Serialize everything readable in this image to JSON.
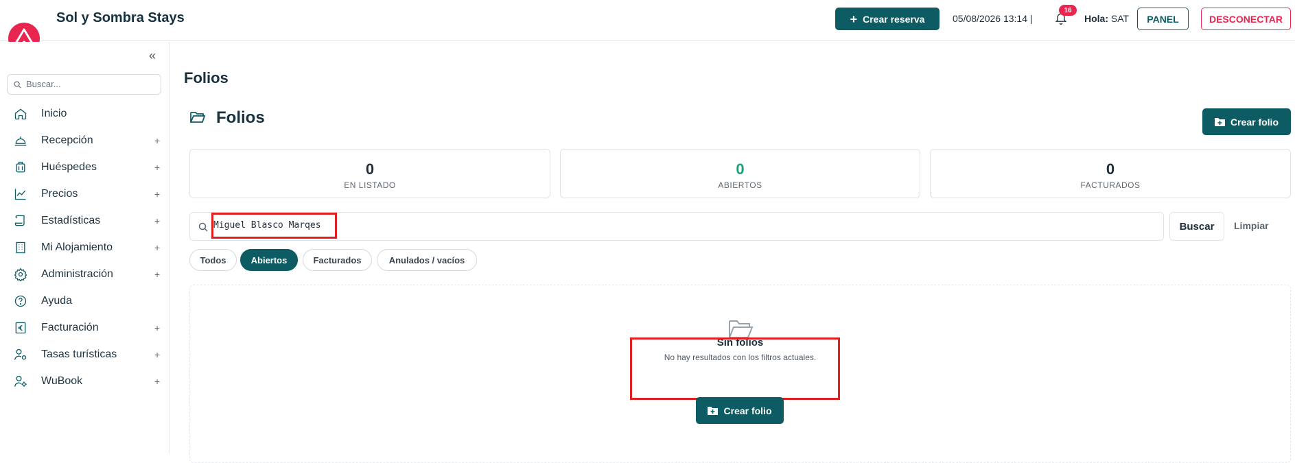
{
  "app": {
    "title": "Sol y Sombra Stays"
  },
  "header": {
    "create_booking": "Crear reserva",
    "datetime": "05/08/2026 13:14 |",
    "notif_count": "16",
    "greeting_label": "Hola:",
    "greeting_user": "SAT",
    "panel": "PANEL",
    "logout": "DESCONECTAR"
  },
  "sidebar": {
    "search_placeholder": "Buscar...",
    "items": [
      {
        "label": "Inicio",
        "icon": "home-icon",
        "expandable": false
      },
      {
        "label": "Recepción",
        "icon": "bell-desk-icon",
        "expandable": true
      },
      {
        "label": "Huéspedes",
        "icon": "luggage-icon",
        "expandable": true
      },
      {
        "label": "Precios",
        "icon": "chart-line-icon",
        "expandable": true
      },
      {
        "label": "Estadísticas",
        "icon": "scroll-icon",
        "expandable": true
      },
      {
        "label": "Mi Alojamiento",
        "icon": "building-icon",
        "expandable": true
      },
      {
        "label": "Administración",
        "icon": "gear-icon",
        "expandable": true
      },
      {
        "label": "Ayuda",
        "icon": "help-icon",
        "expandable": false
      },
      {
        "label": "Facturación",
        "icon": "euro-doc-icon",
        "expandable": true
      },
      {
        "label": "Tasas turísticas",
        "icon": "user-settings-icon",
        "expandable": true
      },
      {
        "label": "WuBook",
        "icon": "user-gear-icon",
        "expandable": true
      }
    ],
    "plus": "+"
  },
  "main": {
    "page_title": "Folios",
    "section_title": "Folios",
    "create_folio": "Crear folio",
    "stats": [
      {
        "value": "0",
        "caption": "EN LISTADO"
      },
      {
        "value": "0",
        "caption": "ABIERTOS"
      },
      {
        "value": "0",
        "caption": "FACTURADOS"
      }
    ],
    "search_value": "Miguel Blasco Marqes",
    "search_button": "Buscar",
    "clear_button": "Limpiar",
    "filters": [
      "Todos",
      "Abiertos",
      "Facturados",
      "Anulados / vacíos"
    ],
    "active_filter": "Abiertos",
    "empty_title": "Sin folios",
    "empty_subtitle": "No hay resultados con los filtros actuales.",
    "empty_create": "Crear folio"
  },
  "colors": {
    "brand": "#e8254f",
    "primary": "#0d5c63",
    "green": "#1aa37a",
    "highlight": "#e02020"
  }
}
